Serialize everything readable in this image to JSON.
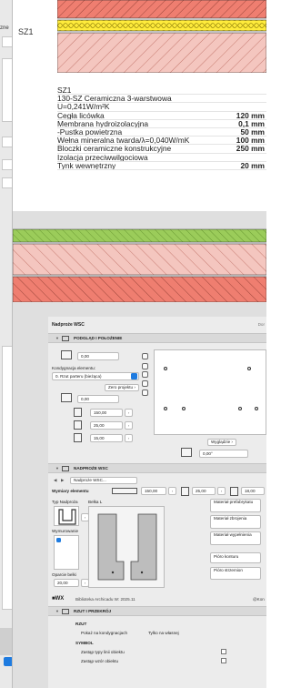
{
  "left_panel": {
    "title": "zne"
  },
  "tab": {
    "label": "SZ1"
  },
  "description": {
    "lines": [
      {
        "text": "SZ1",
        "value": ""
      },
      {
        "text": "130-SZ Ceramiczna  3-warstwowa",
        "value": ""
      },
      {
        "text": "U=0,241W/m²K",
        "value": ""
      },
      {
        "text": "Cegła licówka",
        "value": "120 mm"
      },
      {
        "text": "Membrana hydroizolacyjna",
        "value": "0,1 mm"
      },
      {
        "text": "-Pustka powietrzna",
        "value": "50 mm"
      },
      {
        "text": "Wełna mineralna twarda/λ=0,040W/mK",
        "value": "100 mm"
      },
      {
        "text": "Bloczki ceramiczne konstrukcyjne",
        "value": "250 mm"
      },
      {
        "text": "Izolacja przeciwwilgociowa",
        "value": ""
      },
      {
        "text": "Tynk wewnętrzny",
        "value": "20 mm"
      }
    ]
  },
  "dialog": {
    "title": "Nadproże WSC",
    "title_right": "Dor",
    "section_floor": "PODGLĄD I POŁOŻENIE",
    "elevation_value": "0,00",
    "floor_label": "Kondygnacja elementu:",
    "floor_value": "0. Rzut parteru (bieżąca)",
    "zero_project": "Zero projektu",
    "zero_value": "0,00",
    "dim_1": "150,00",
    "dim_2": "25,00",
    "dim_3": "15,00",
    "view_btn": "Wyglądzie",
    "angle_value": "0,00°",
    "section_lintel": "NADPROŻE WSC",
    "nav_label": "Nadproże WSC...",
    "dims_label": "Wymiary elementu",
    "dims_v1": "150,00",
    "dims_v2": "25,00",
    "dims_v3": "18,00",
    "lintel_type_label": "Typ Nadproża",
    "beam_label": "Belka L",
    "fill_label": "Wymurowanie",
    "support_label": "Oparcie belki",
    "support_value": "20,00",
    "materials": [
      "Materiał prefabrykatu",
      "Materiał zbrojenia",
      "Materiał wypełnienia"
    ],
    "pen_labels": [
      "Pióro konturu",
      "Pióro strzemion"
    ],
    "library_text": "Biblioteka Archicadu W: 2025.11",
    "library_right": "@Kon",
    "section_plan": "RZUT I PRZEKRÓJ",
    "plan_header": "RZUT",
    "show_on_floors_label": "Pokaż na kondygnacjach",
    "show_on_floors_value": "Tylko na własnej",
    "symbol_header": "SYMBOL",
    "line_type_label": "Zastąp typy linii obiektu",
    "fill_type_label": "Zastąp wzór obiektu"
  },
  "colors": {
    "brick": "#ef7e70",
    "membrane": "#ffeb3b",
    "insulation_green": "#9bcc5a",
    "block_pink": "#f4c6bf",
    "accent_blue": "#1e7be0"
  }
}
